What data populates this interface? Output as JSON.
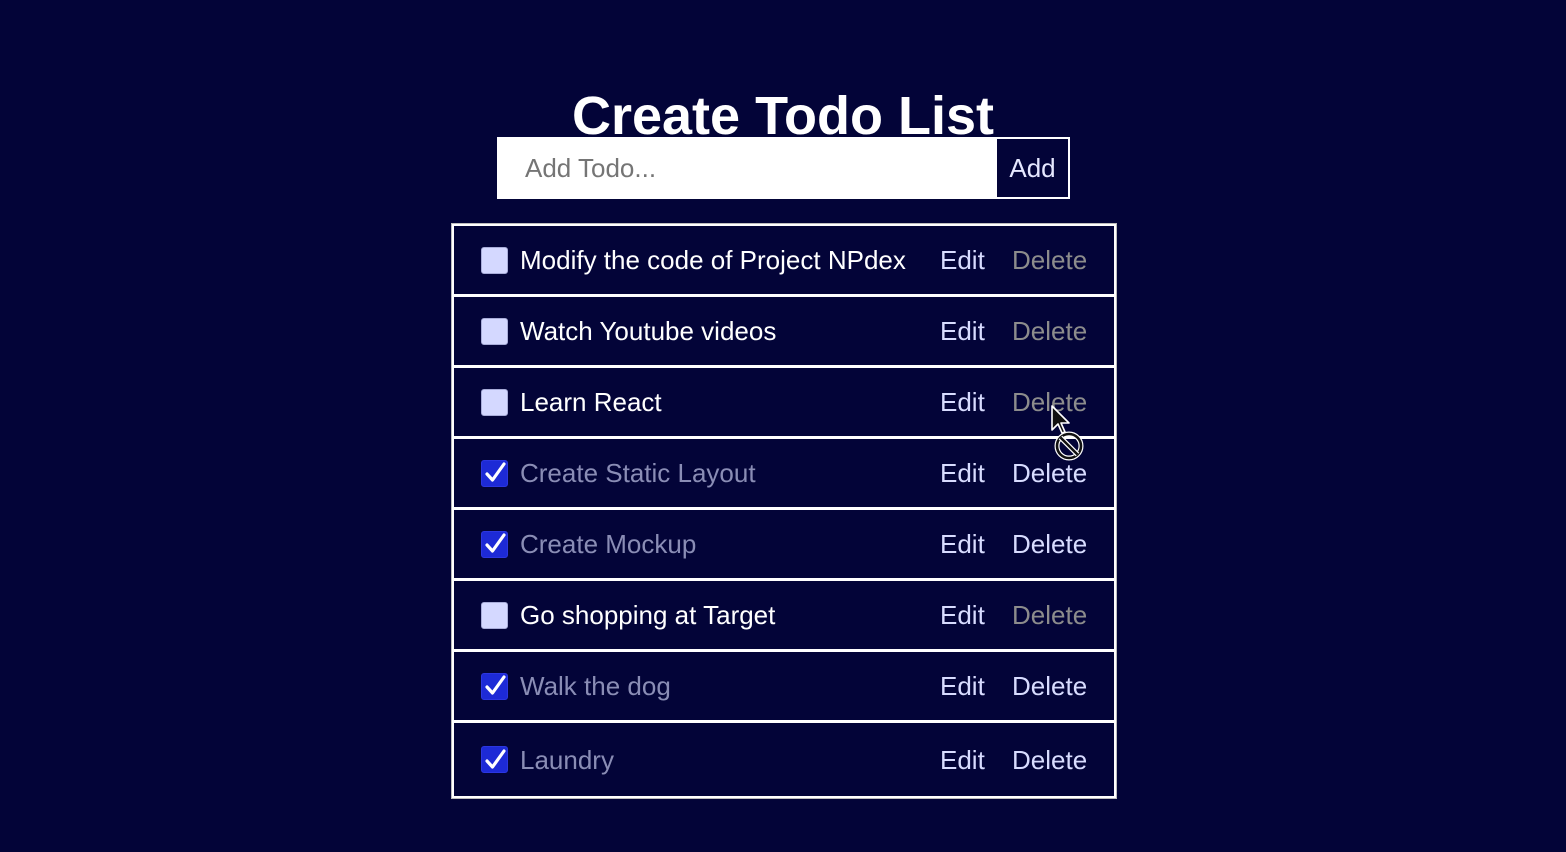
{
  "header": {
    "title": "Create Todo List"
  },
  "add_form": {
    "placeholder": "Add Todo...",
    "value": "",
    "button_label": "Add"
  },
  "todos": [
    {
      "text": "Modify the code of Project NPdex",
      "completed": false,
      "edit_label": "Edit",
      "delete_label": "Delete",
      "delete_enabled": false
    },
    {
      "text": "Watch Youtube videos",
      "completed": false,
      "edit_label": "Edit",
      "delete_label": "Delete",
      "delete_enabled": false
    },
    {
      "text": "Learn React",
      "completed": false,
      "edit_label": "Edit",
      "delete_label": "Delete",
      "delete_enabled": false
    },
    {
      "text": "Create Static Layout",
      "completed": true,
      "edit_label": "Edit",
      "delete_label": "Delete",
      "delete_enabled": true
    },
    {
      "text": "Create Mockup",
      "completed": true,
      "edit_label": "Edit",
      "delete_label": "Delete",
      "delete_enabled": true
    },
    {
      "text": "Go shopping at Target",
      "completed": false,
      "edit_label": "Edit",
      "delete_label": "Delete",
      "delete_enabled": false
    },
    {
      "text": "Walk the dog",
      "completed": true,
      "edit_label": "Edit",
      "delete_label": "Delete",
      "delete_enabled": true
    },
    {
      "text": "Laundry",
      "completed": true,
      "edit_label": "Edit",
      "delete_label": "Delete",
      "delete_enabled": true
    }
  ],
  "colors": {
    "background": "#030438",
    "checkbox_checked": "#1d2ad6",
    "checkbox_unchecked": "#d4d8ff",
    "completed_text": "#8a8db5",
    "disabled_delete": "#8c8c8c"
  },
  "cursor": {
    "icon": "not-allowed-cursor-icon"
  }
}
